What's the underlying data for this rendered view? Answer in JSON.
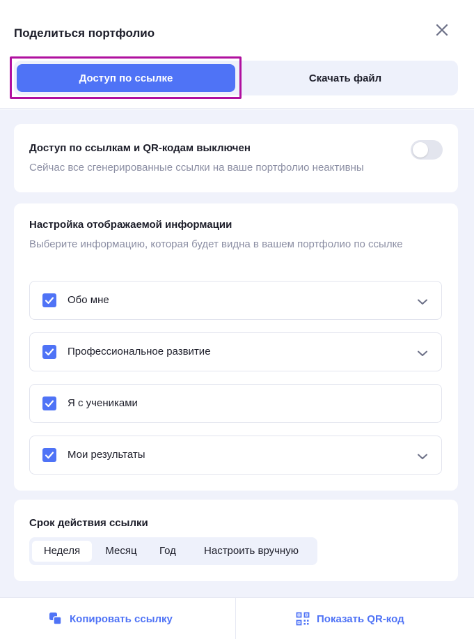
{
  "dialog": {
    "title": "Поделиться портфолио"
  },
  "tabs": [
    {
      "label": "Доступ по ссылке",
      "active": true
    },
    {
      "label": "Скачать файл",
      "active": false
    }
  ],
  "access": {
    "title": "Доступ по ссылкам и QR-кодам выключен",
    "description": "Сейчас все сгенерированные ссылки на ваше портфолио неактивны",
    "enabled": false
  },
  "display_settings": {
    "title": "Настройка отображаемой информации",
    "description": "Выберите информацию, которая будет видна в вашем портфолио по ссылке",
    "items": [
      {
        "label": "Обо мне",
        "checked": true,
        "expandable": true
      },
      {
        "label": "Профессиональное развитие",
        "checked": true,
        "expandable": true
      },
      {
        "label": "Я с учениками",
        "checked": true,
        "expandable": false
      },
      {
        "label": "Мои результаты",
        "checked": true,
        "expandable": true
      }
    ]
  },
  "link_period": {
    "title": "Срок действия ссылки",
    "options": [
      "Неделя",
      "Месяц",
      "Год",
      "Настроить вручную"
    ],
    "selected": "Неделя"
  },
  "footer": {
    "copy_label": "Копировать ссылку",
    "qr_label": "Показать QR-код"
  },
  "colors": {
    "accent": "#4f73f6",
    "highlight": "#b0109f",
    "background": "#f0f2fb"
  }
}
